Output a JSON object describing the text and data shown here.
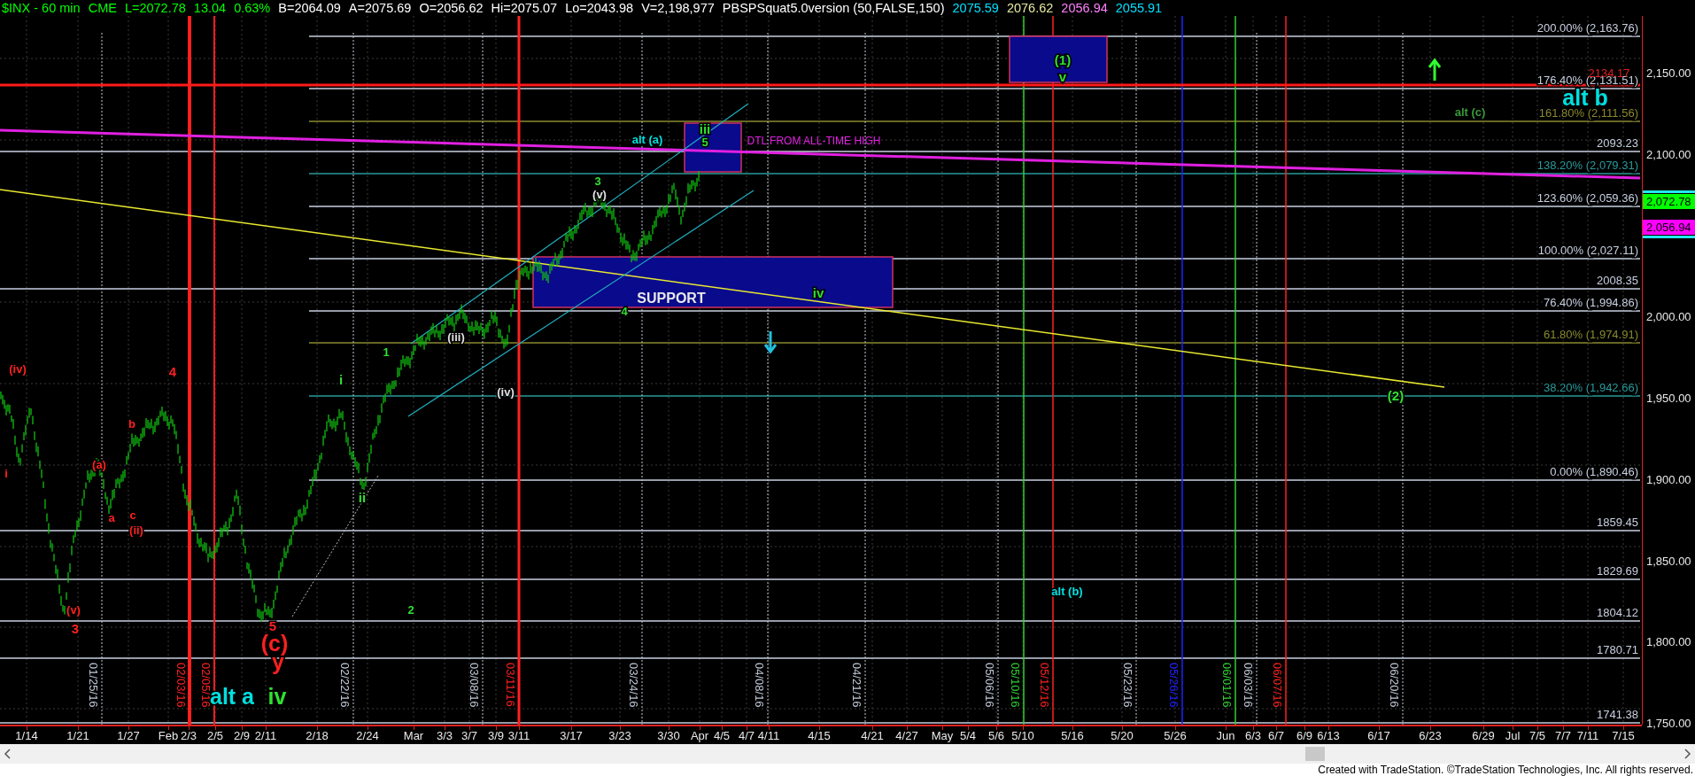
{
  "header": [
    {
      "text": "$INX - 60 min",
      "color": "#00ff00"
    },
    {
      "text": "CME",
      "color": "#00ff00"
    },
    {
      "text": "L=2072.78",
      "color": "#00ff00"
    },
    {
      "text": "13.04",
      "color": "#00ff00"
    },
    {
      "text": "0.63%",
      "color": "#00ff00"
    },
    {
      "text": "B=2064.09",
      "color": "#ffffff"
    },
    {
      "text": "A=2075.69",
      "color": "#ffffff"
    },
    {
      "text": "O=2056.62",
      "color": "#ffffff"
    },
    {
      "text": "Hi=2075.07",
      "color": "#ffffff"
    },
    {
      "text": "Lo=2043.98",
      "color": "#ffffff"
    },
    {
      "text": "V=2,198,977",
      "color": "#ffffff"
    },
    {
      "text": "PBSPSquat5.0version (50,FALSE,150)",
      "color": "#ffffff"
    },
    {
      "text": "2075.59",
      "color": "#00e0ff"
    },
    {
      "text": "2076.62",
      "color": "#e8e8a0"
    },
    {
      "text": "2056.94",
      "color": "#ff80ff"
    },
    {
      "text": "2055.91",
      "color": "#00e0ff"
    }
  ],
  "chart": {
    "fib_levels": [
      {
        "label": "200.00% (2,163.76)",
        "color": "#c8d0e0"
      },
      {
        "label": "176.40% (2,131.51)",
        "color": "#c8d0e0"
      },
      {
        "label": "161.80% (2,111.56)",
        "color": "#8a8a30"
      },
      {
        "label": "2093.23",
        "color": "#c8d0e0"
      },
      {
        "label": "138.20% (2,079.31)",
        "color": "#2a9a9a"
      },
      {
        "label": "123.60% (2,059.36)",
        "color": "#c8d0e0"
      },
      {
        "label": "100.00% (2,027.11)",
        "color": "#c8d0e0"
      },
      {
        "label": "2008.35",
        "color": "#c8d0e0"
      },
      {
        "label": "76.40% (1,994.86)",
        "color": "#c8d0e0"
      },
      {
        "label": "61.80% (1,974.91)",
        "color": "#8a8a30"
      },
      {
        "label": "38.20% (1,942.66)",
        "color": "#2a9a9a"
      },
      {
        "label": "0.00% (1,890.46)",
        "color": "#c8d0e0"
      },
      {
        "label": "1859.45",
        "color": "#c8d0e0"
      },
      {
        "label": "1829.69",
        "color": "#c8d0e0"
      },
      {
        "label": "1804.12",
        "color": "#c8d0e0"
      },
      {
        "label": "1780.71",
        "color": "#c8d0e0"
      },
      {
        "label": "1741.38",
        "color": "#c8d0e0"
      }
    ],
    "date_markers": [
      {
        "label": "01/25/16",
        "color": "#c0c8d8"
      },
      {
        "label": "02/03/16",
        "color": "#ff2020"
      },
      {
        "label": "02/05/16",
        "color": "#ff2020"
      },
      {
        "label": "02/22/16",
        "color": "#c0c8d8"
      },
      {
        "label": "03/08/16",
        "color": "#c0c8d8"
      },
      {
        "label": "03/11/16",
        "color": "#ff2020"
      },
      {
        "label": "03/24/16",
        "color": "#c0c8d8"
      },
      {
        "label": "04/08/16",
        "color": "#c0c8d8"
      },
      {
        "label": "04/21/16",
        "color": "#c0c8d8"
      },
      {
        "label": "05/06/16",
        "color": "#c0c8d8"
      },
      {
        "label": "05/10/16",
        "color": "#30d030"
      },
      {
        "label": "05/12/16",
        "color": "#ff2020"
      },
      {
        "label": "05/23/16",
        "color": "#c0c8d8"
      },
      {
        "label": "05/26/16",
        "color": "#2020ff"
      },
      {
        "label": "06/01/16",
        "color": "#30d030"
      },
      {
        "label": "06/03/16",
        "color": "#c0c8d8"
      },
      {
        "label": "06/07/16",
        "color": "#ff2020"
      },
      {
        "label": "06/20/16",
        "color": "#c0c8d8"
      }
    ],
    "wave_labels": [
      {
        "text": "(iv)",
        "color": "#ff2020",
        "kind": "small"
      },
      {
        "text": "i",
        "color": "#ff2020",
        "kind": "small"
      },
      {
        "text": "(v)",
        "color": "#ff2020",
        "kind": "small"
      },
      {
        "text": "3",
        "color": "#ff2020",
        "kind": "medium"
      },
      {
        "text": "4",
        "color": "#ff2020",
        "kind": "medium"
      },
      {
        "text": "(a)",
        "color": "#ff2020",
        "kind": "small"
      },
      {
        "text": "b",
        "color": "#ff2020",
        "kind": "small"
      },
      {
        "text": "a",
        "color": "#ff2020",
        "kind": "small"
      },
      {
        "text": "c",
        "color": "#ff2020",
        "kind": "small"
      },
      {
        "text": "(ii)",
        "color": "#ff2020",
        "kind": "small"
      },
      {
        "text": "5",
        "color": "#ff2020",
        "kind": "medium"
      },
      {
        "text": "(c)",
        "color": "#ff2020",
        "kind": "large"
      },
      {
        "text": "y",
        "color": "#ff2020",
        "kind": "large"
      },
      {
        "text": "alt a",
        "color": "#00e0e0",
        "kind": "large"
      },
      {
        "text": "iv",
        "color": "#30e030",
        "kind": "large"
      },
      {
        "text": "i",
        "color": "#30e030",
        "kind": "medium"
      },
      {
        "text": "ii",
        "color": "#30e030",
        "kind": "medium"
      },
      {
        "text": "1",
        "color": "#30e030",
        "kind": "small"
      },
      {
        "text": "2",
        "color": "#30e030",
        "kind": "small"
      },
      {
        "text": "(iii)",
        "color": "#e0e0e0",
        "kind": "small"
      },
      {
        "text": "(iv)",
        "color": "#e0e0e0",
        "kind": "small"
      },
      {
        "text": "3",
        "color": "#30e030",
        "kind": "small"
      },
      {
        "text": "(v)",
        "color": "#e0e0e0",
        "kind": "small"
      },
      {
        "text": "4",
        "color": "#30e030",
        "kind": "small"
      },
      {
        "text": "alt (a)",
        "color": "#00e0e0",
        "kind": "small"
      },
      {
        "text": "iii",
        "color": "#30e030",
        "kind": "medium"
      },
      {
        "text": "5",
        "color": "#30e030",
        "kind": "small"
      },
      {
        "text": "iv",
        "color": "#30e030",
        "kind": "medium"
      },
      {
        "text": "(1)",
        "color": "#30e030",
        "kind": "medium"
      },
      {
        "text": "v",
        "color": "#30e030",
        "kind": "medium"
      },
      {
        "text": "(2)",
        "color": "#30e030",
        "kind": "medium"
      },
      {
        "text": "alt (b)",
        "color": "#00e0e0",
        "kind": "small"
      },
      {
        "text": "alt b",
        "color": "#00e0e0",
        "kind": "large"
      },
      {
        "text": "alt (c)",
        "color": "#3a9a3a",
        "kind": "small"
      }
    ],
    "notes": [
      {
        "text": "DTL FROM ALL-TIME HIGH",
        "color": "#e020e0"
      },
      {
        "text": "SUPPORT",
        "color": "#e8e8e8"
      },
      {
        "text": "2134.17",
        "color": "#e02020"
      }
    ],
    "price_axis": [
      "2,150.00",
      "2,100.00",
      "2,000.00",
      "1,950.00",
      "1,900.00",
      "1,850.00",
      "1,800.00",
      "1,750.00"
    ],
    "price_tags": [
      {
        "text": "2,072.78",
        "color": "#00ff00"
      },
      {
        "text": "2,056.94",
        "color": "#ff00ff"
      }
    ],
    "date_axis": [
      "1/14",
      "1/21",
      "1/27",
      "Feb",
      "2/3",
      "2/5",
      "2/9",
      "2/11",
      "2/18",
      "2/24",
      "Mar",
      "3/3",
      "3/7",
      "3/9",
      "3/11",
      "3/17",
      "3/23",
      "3/30",
      "Apr",
      "4/5",
      "4/7",
      "4/11",
      "4/15",
      "4/21",
      "4/27",
      "May",
      "5/4",
      "5/6",
      "5/10",
      "5/16",
      "5/20",
      "5/26",
      "Jun",
      "6/3",
      "6/7",
      "6/9",
      "6/13",
      "6/17",
      "6/23",
      "6/29",
      "Jul",
      "7/5",
      "7/7",
      "7/11",
      "7/15"
    ]
  },
  "footer": "Created with TradeStation. ©TradeStation Technologies, Inc. All rights reserved."
}
